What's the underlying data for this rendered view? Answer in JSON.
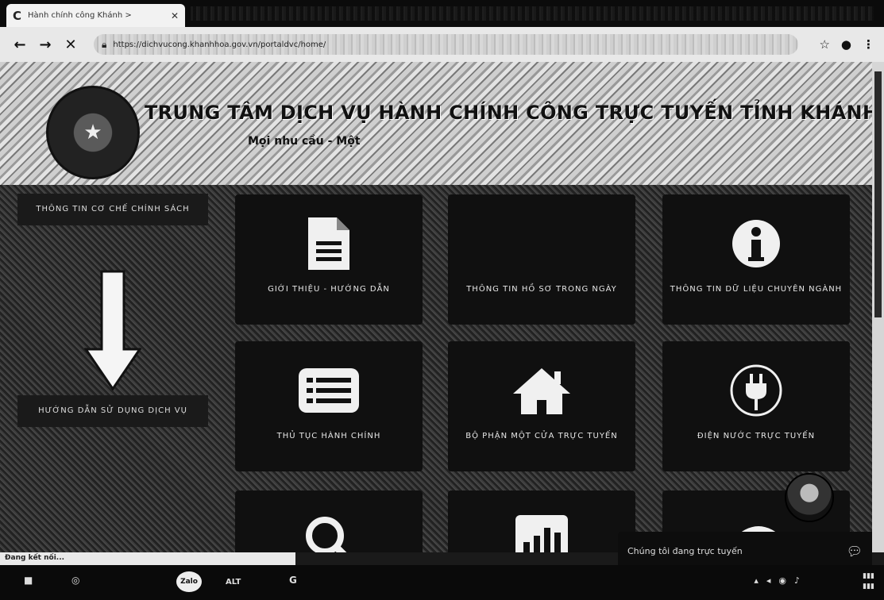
{
  "browser": {
    "tab_title": "Hành chính công Khánh >",
    "tab_close": "✕",
    "nav": {
      "back": "←",
      "forward": "→",
      "stop": "✕"
    },
    "url": "https://dichvucong.khanhhoa.gov.vn/portaldvc/home/",
    "right_icons": [
      "☆",
      "●",
      "⋮"
    ]
  },
  "banner": {
    "title": "TRUNG TÂM DỊCH VỤ HÀNH CHÍNH CÔNG TRỰC TUYẾN TỈNH KHÁNH HÒA",
    "subtitle": "Mọi nhu cầu - Một"
  },
  "sidebar": [
    {
      "label": "THÔNG TIN CƠ CHẾ CHÍNH SÁCH"
    },
    {
      "label": "HƯỚNG DẪN SỬ DỤNG DỊCH VỤ"
    }
  ],
  "tiles": [
    {
      "label": "GIỚI THIỆU - HƯỚNG DẪN",
      "icon": "document-icon"
    },
    {
      "label": "THÔNG TIN HỒ SƠ TRONG NGÀY",
      "icon": ""
    },
    {
      "label": "THÔNG TIN DỮ LIỆU CHUYÊN NGÀNH",
      "icon": "info-icon"
    },
    {
      "label": "THỦ TỤC HÀNH CHÍNH",
      "icon": "list-icon"
    },
    {
      "label": "BỘ PHẬN MỘT CỬA TRỰC TUYẾN",
      "icon": "home-icon"
    },
    {
      "label": "ĐIỆN NƯỚC TRỰC TUYẾN",
      "icon": "plug-icon"
    },
    {
      "label": "",
      "icon": "search-icon"
    },
    {
      "label": "",
      "icon": "bar-chart-icon"
    },
    {
      "label": "",
      "icon": ""
    }
  ],
  "chat": {
    "text": "Chúng tôi đang trực tuyến",
    "icon": "chat-icon"
  },
  "status_bar": "Đang kết nối...",
  "taskbar": {
    "zalo": "Zalo",
    "item2": "ALT",
    "item3": "G"
  }
}
